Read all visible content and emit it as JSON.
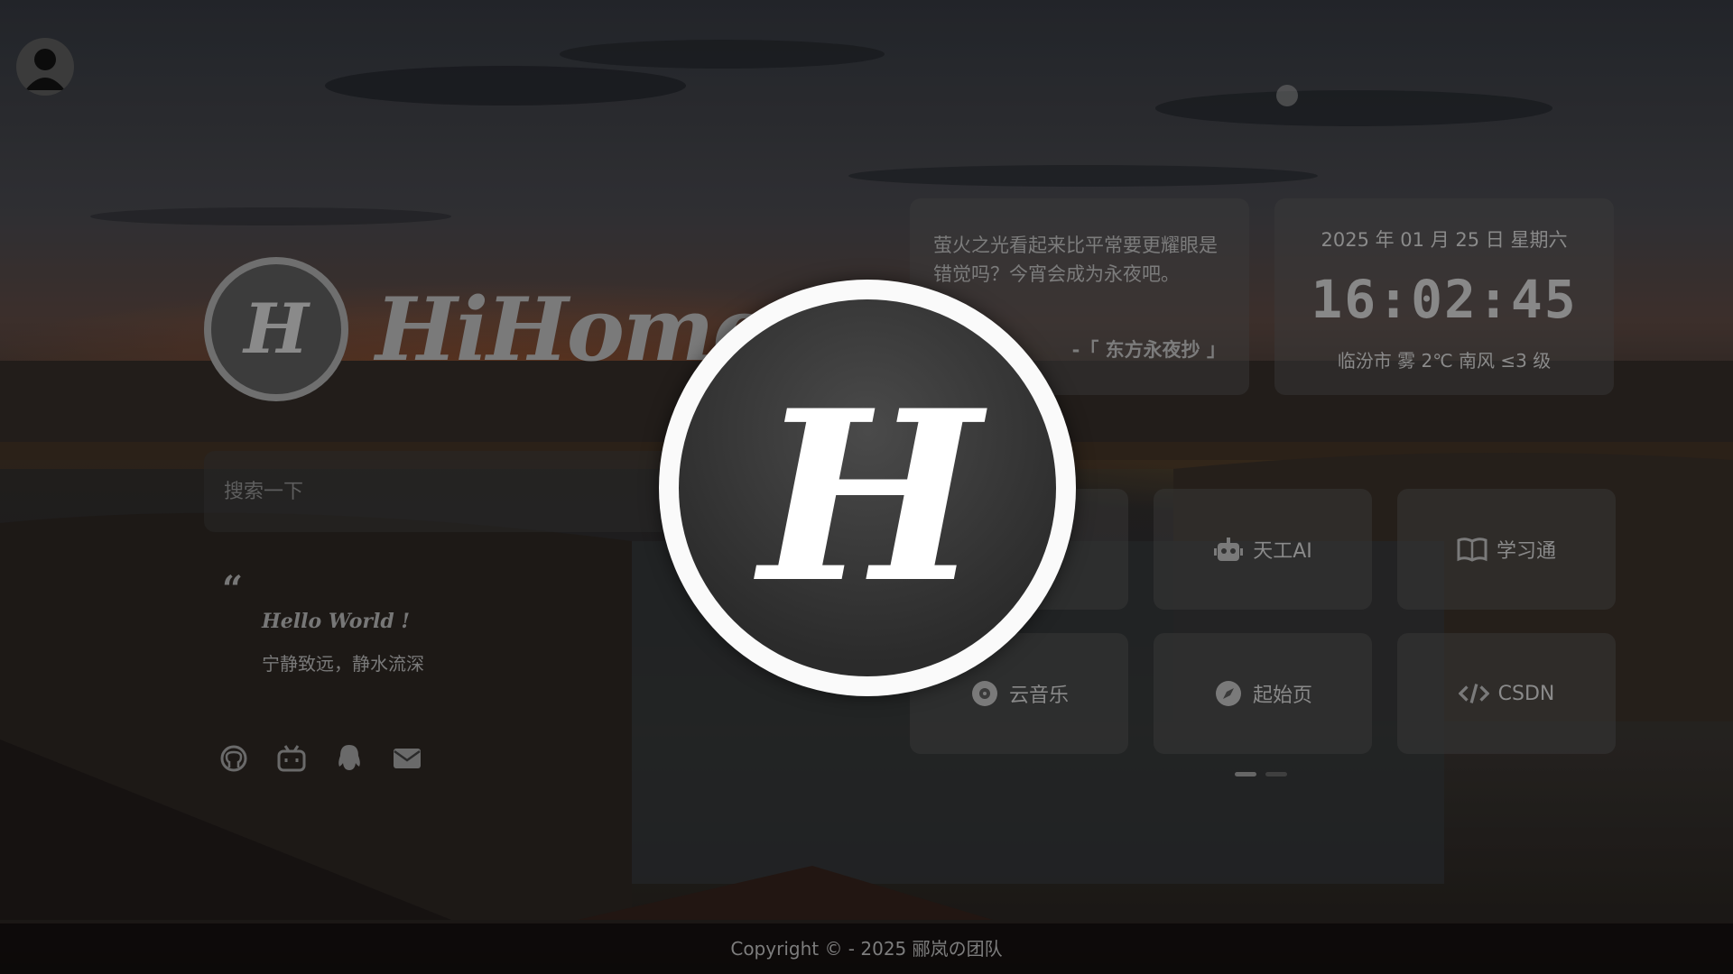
{
  "brand": {
    "name": "HiHome",
    "logo_letter": "H"
  },
  "search": {
    "placeholder": "搜索一下",
    "value": ""
  },
  "hello": {
    "quote_mark": "“",
    "title": "Hello World !",
    "text": "宁静致远，静水流深"
  },
  "socials": [
    {
      "icon": "github-icon"
    },
    {
      "icon": "bilibili-icon"
    },
    {
      "icon": "qq-icon"
    },
    {
      "icon": "mail-icon"
    }
  ],
  "hitokoto": {
    "text": "萤火之光看起来比平常要更耀眼是错觉吗？今宵会成为永夜吧。",
    "from": "-「 东方永夜抄 」"
  },
  "clock": {
    "date": "2025 年 01 月 25 日 星期六",
    "time": "16:02:45",
    "weather": "临汾市 雾 2℃  南风  ≤3 级"
  },
  "links": [
    {
      "label": "天工AI",
      "icon": "robot-icon"
    },
    {
      "label": "学习通",
      "icon": "book-icon"
    },
    {
      "label": "云音乐",
      "icon": "disc-icon"
    },
    {
      "label": "起始页",
      "icon": "compass-icon"
    },
    {
      "label": "CSDN",
      "icon": "code-icon"
    }
  ],
  "pagination": {
    "count": 2,
    "active": 1
  },
  "footer": {
    "text": "Copyright © - 2025 郦岚の团队"
  },
  "loader": {
    "letter": "H"
  },
  "colors": {
    "loader_ring": "#fafafa",
    "loader_bg": "#333333",
    "card_bg": "#3c3c3c"
  }
}
